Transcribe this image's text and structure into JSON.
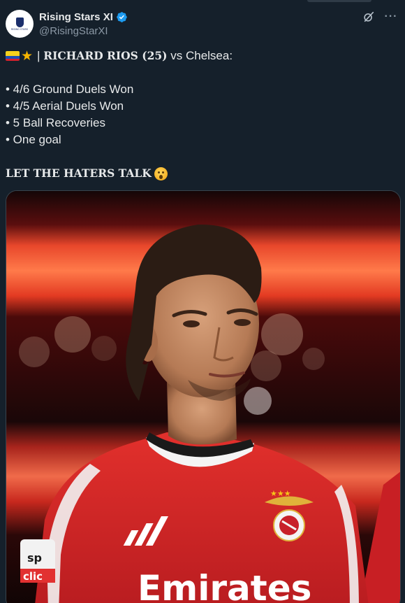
{
  "author": {
    "display_name": "Rising Stars XI",
    "handle": "@RisingStarXI",
    "avatar_text": "RISING STARS",
    "verified": true
  },
  "header_icons": [
    "grok-icon",
    "more-icon"
  ],
  "tweet": {
    "headline_prefix": "| ",
    "headline_player": "RICHARD RIOS (25)",
    "headline_suffix": " vs Chelsea:",
    "stats": [
      "• 4/6 Ground Duels Won",
      "• 4/5 Aerial Duels Won",
      "• 5 Ball Recoveries",
      "• One goal"
    ],
    "closing": "LET THE HATERS TALK",
    "emojis": [
      "colombia-flag",
      "star",
      "hushed-face"
    ]
  },
  "media": {
    "kind": "photo",
    "shirt_sponsor": "Emirates",
    "sleeve_text_top": "sp",
    "sleeve_text_bottom": "clic"
  },
  "colors": {
    "background": "#15202b",
    "text": "#e7e9ea",
    "muted": "#8b98a5",
    "verified_blue": "#1d9bf0",
    "jersey_red": "#d8262b"
  }
}
